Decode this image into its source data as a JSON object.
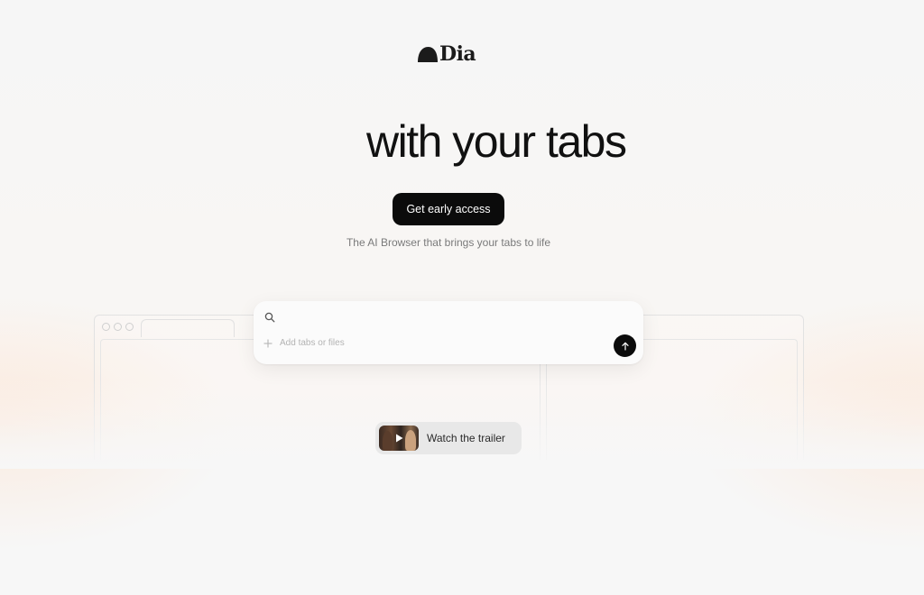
{
  "brand": {
    "name": "Dia"
  },
  "hero": {
    "headline": "with your tabs",
    "cta_label": "Get early access",
    "tagline": "The AI Browser that brings your tabs to life"
  },
  "search": {
    "value": "",
    "placeholder": "",
    "add_label": "Add tabs or files"
  },
  "trailer": {
    "label": "Watch the trailer"
  },
  "icons": {
    "logo": "dia-logo-mark",
    "search": "search-icon",
    "add": "plus-icon",
    "submit": "arrow-up-icon",
    "play": "play-icon"
  },
  "colors": {
    "primary_button": "#0b0b0b",
    "background": "#f7f7f7",
    "accent_glow": "#fde1cd"
  }
}
